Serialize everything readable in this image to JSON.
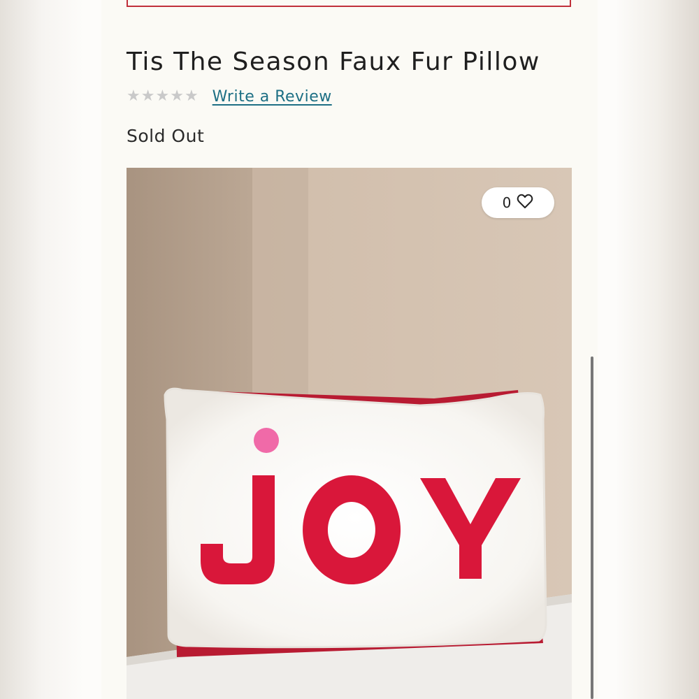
{
  "product": {
    "title": "Tis The Season Faux Fur Pillow",
    "rating": {
      "stars": "★★★★★",
      "value": 0,
      "max": 5
    },
    "review_link": "Write a Review",
    "availability": "Sold Out"
  },
  "image": {
    "favorites_count": "0",
    "favorite_icon": "heart-outline-icon",
    "pillow_text": "JOY"
  },
  "colors": {
    "promo_border": "#c0303a",
    "link": "#1d6f84",
    "star_empty": "#c9c9c9",
    "joy_red": "#d9173a",
    "dot_pink": "#f06aa8"
  }
}
